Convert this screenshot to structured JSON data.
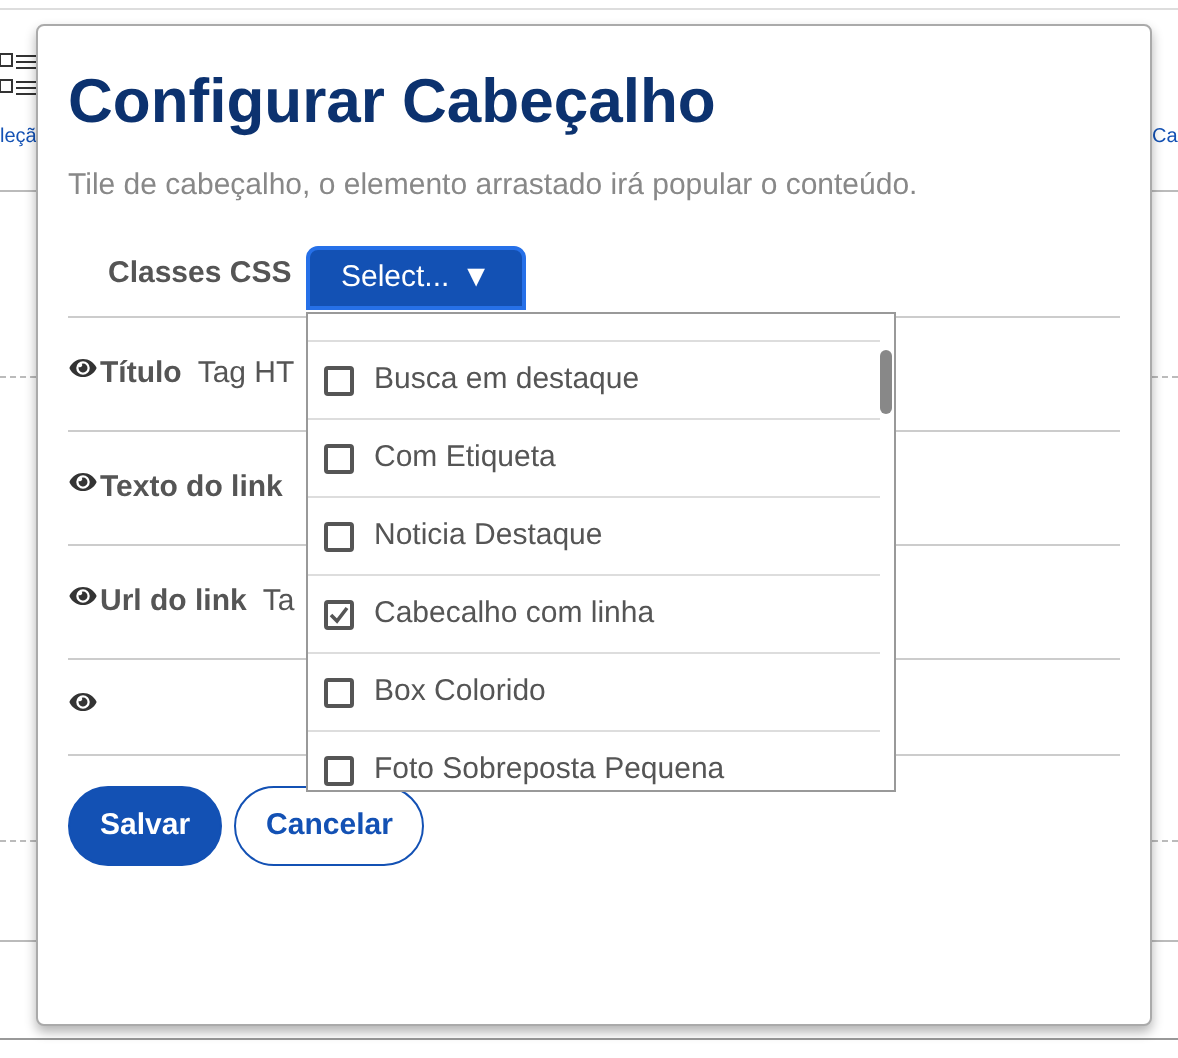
{
  "background": {
    "left_link": "leçã",
    "right_link": "Ca"
  },
  "dialog": {
    "title": "Configurar Cabeçalho",
    "subtitle": "Tile de cabeçalho, o elemento arrastado irá popular o conteúdo.",
    "css_label": "Classes CSS",
    "select": {
      "label": "Select...",
      "arrow": "▼",
      "expanded": true,
      "options": [
        {
          "label": "Busca em destaque",
          "checked": false
        },
        {
          "label": "Com Etiqueta",
          "checked": false
        },
        {
          "label": "Noticia Destaque",
          "checked": false
        },
        {
          "label": "Cabecalho com linha",
          "checked": true
        },
        {
          "label": "Box Colorido",
          "checked": false
        },
        {
          "label": "Foto Sobreposta Pequena",
          "checked": false
        }
      ]
    },
    "fields": [
      {
        "kind": "labeled",
        "label": "Título",
        "value": "Tag HT"
      },
      {
        "kind": "labeled",
        "label": "Texto do link"
      },
      {
        "kind": "labeled",
        "label": "Url do link",
        "value": "Ta"
      },
      {
        "kind": "eye_only"
      }
    ],
    "buttons": [
      {
        "label": "Salvar",
        "kind": "primary"
      },
      {
        "label": "Cancelar",
        "kind": "secondary"
      }
    ]
  }
}
